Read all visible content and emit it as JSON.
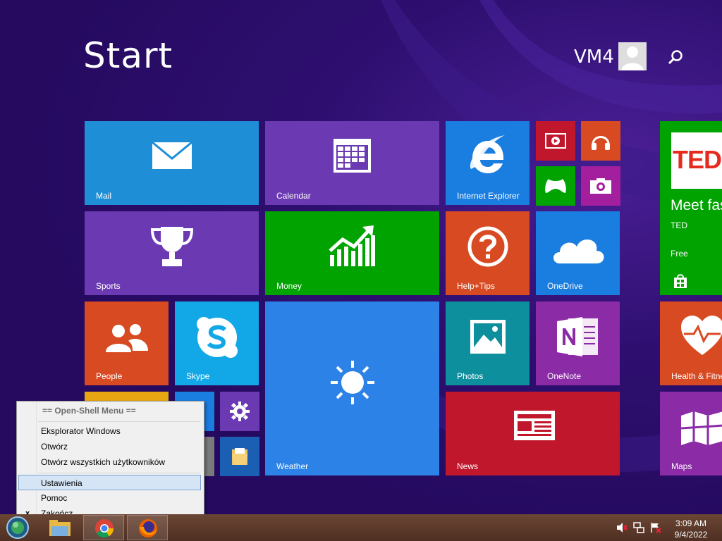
{
  "start": {
    "title": "Start",
    "user": "VM4"
  },
  "tiles": {
    "mail": "Mail",
    "calendar": "Calendar",
    "ie": "Internet Explorer",
    "sports": "Sports",
    "money": "Money",
    "help": "Help+Tips",
    "onedrive": "OneDrive",
    "people": "People",
    "skype": "Skype",
    "weather": "Weather",
    "photos": "Photos",
    "onenote": "OneNote",
    "news": "News",
    "maps": "Maps",
    "health": "Health & Fitne",
    "ted": {
      "logo": "TED",
      "headline": "Meet fas",
      "publisher": "TED",
      "price": "Free"
    }
  },
  "menu": {
    "header": "== Open-Shell Menu ==",
    "items": [
      "Eksplorator Windows",
      "Otwórz",
      "Otwórz wszystkich użytkowników",
      "Ustawienia",
      "Pomoc",
      "Zakończ"
    ],
    "check_mark": "x"
  },
  "taskbar": {
    "time": "3:09 AM",
    "date": "9/4/2022"
  },
  "colors": {
    "background": "#2d0d6b",
    "mail": "#1e8fd6",
    "calendar": "#6b3ab3",
    "green": "#00a300",
    "orange": "#d84a22",
    "taskbar": "#5b3a2a"
  }
}
